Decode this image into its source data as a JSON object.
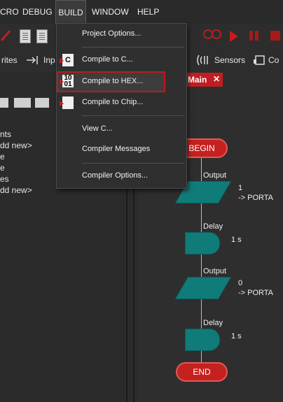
{
  "menubar": {
    "items": [
      "CRO",
      "DEBUG",
      "BUILD",
      "WINDOW",
      "HELP"
    ],
    "active": "BUILD"
  },
  "toolbar": {
    "row2": {
      "writes": "rites",
      "inp": "Inp",
      "sensors": "Sensors",
      "co": "Co"
    }
  },
  "left_panel": {
    "items": [
      "nts",
      "dd new>",
      "e",
      "e",
      "es",
      "dd new>"
    ]
  },
  "editor": {
    "tab_label": "Main",
    "tab_close": "✕"
  },
  "flowchart": {
    "begin": "BEGIN",
    "end": "END",
    "output1_label": "Output",
    "output1_value": "1",
    "output1_target": "-> PORTA",
    "delay1_label": "Delay",
    "delay1_value": "1 s",
    "output2_label": "Output",
    "output2_value": "0",
    "output2_target": "-> PORTA",
    "delay2_label": "Delay",
    "delay2_value": "1 s"
  },
  "build_menu": {
    "project_options": "Project Options...",
    "compile_to_c": "Compile to C...",
    "compile_to_hex": "Compile to HEX...",
    "compile_to_chip": "Compile to Chip...",
    "view_c": "View C...",
    "compiler_messages": "Compiler Messages",
    "compiler_options": "Compiler Options...",
    "icon_c": "C",
    "icon_hex_top": "10",
    "icon_hex_bottom": "01"
  },
  "colors": {
    "accent_red": "#c21e22",
    "flow_teal": "#0f7c7a",
    "background": "#2b2b2b"
  }
}
